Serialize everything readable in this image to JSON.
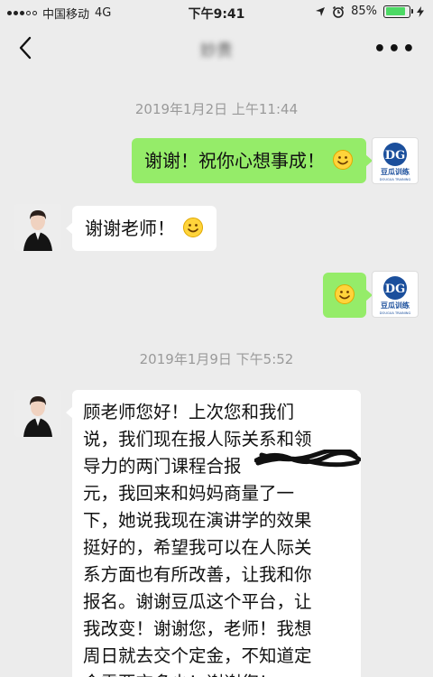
{
  "status_bar": {
    "carrier": "中国移动",
    "network": "4G",
    "time": "下午9:41",
    "battery": "85%",
    "battery_level": 0.85
  },
  "nav": {
    "title": "妙贵"
  },
  "messages": {
    "ts1": "2019年1月2日 上午11:44",
    "m1_text": "谢谢！祝你心想事成！",
    "m2_text": "谢谢老师！",
    "ts2": "2019年1月9日 下午5:52",
    "m4_text": "顾老师您好！上次您和我们\n说，我们现在报人际关系和领\n导力的两门课程合报\n元，我回来和妈妈商量了一\n下，她说我现在演讲学的效果\n挺好的，希望我可以在人际关\n系方面也有所改善，让我和你\n报名。谢谢豆瓜这个平台，让\n我改变！谢谢您，老师！我想\n周日就去交个定金，不知道定\n金需要交多少！谢谢您！"
  },
  "logo": {
    "initials": "DG",
    "name": "豆瓜训练",
    "subtitle": "DOUGUA TRAINING"
  },
  "colors": {
    "sent_bubble": "#95ec69",
    "received_bubble": "#ffffff",
    "background": "#ececec",
    "logo_blue": "#1b4f9c"
  },
  "icons": {
    "back": "chevron-left-icon",
    "more": "more-dots-icon",
    "emoji": "smiley-face-icon"
  }
}
